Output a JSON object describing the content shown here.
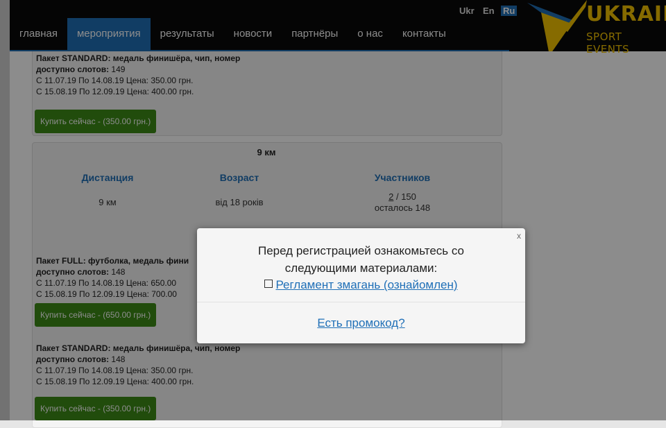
{
  "header": {
    "languages": [
      {
        "label": "Ukr",
        "active": false
      },
      {
        "label": "En",
        "active": false
      },
      {
        "label": "Ru",
        "active": true
      }
    ],
    "nav": [
      {
        "label": "главная",
        "active": false
      },
      {
        "label": "мероприятия",
        "active": true
      },
      {
        "label": "результаты",
        "active": false
      },
      {
        "label": "новости",
        "active": false
      },
      {
        "label": "партнёры",
        "active": false
      },
      {
        "label": "о нас",
        "active": false
      },
      {
        "label": "контакты",
        "active": false
      }
    ],
    "logo": {
      "line1": "UKRAINE",
      "line2": "SPORT EVENTS"
    }
  },
  "top_package": {
    "title": "Пакет STANDARD: медаль финишёра, чип, номер",
    "slots_label": "доступно слотов:",
    "slots_value": "149",
    "price1": "С 11.07.19 По 14.08.19 Цена: 350.00 грн.",
    "price2": "С 15.08.19 По 12.09.19 Цена: 400.00 грн.",
    "buy_button": "Купить сейчас - (350.00 грн.)"
  },
  "distance_card": {
    "title": "9 км",
    "headers": {
      "distance": "Дистанция",
      "age": "Возраст",
      "participants": "Участников"
    },
    "values": {
      "distance": "9 км",
      "age": "від 18 років",
      "participants_count": "2",
      "participants_total": "/ 150",
      "remaining": "осталось 148"
    }
  },
  "full_package": {
    "title": "Пакет FULL: футболка, медаль фини",
    "slots_label": "доступно слотов:",
    "slots_value": "148",
    "price1": "С 11.07.19 По 14.08.19 Цена: 650.00",
    "price2": "С 15.08.19 По 12.09.19 Цена: 700.00",
    "buy_button": "Купить сейчас - (650.00 грн.)"
  },
  "standard_package": {
    "title": "Пакет STANDARD: медаль финишёра, чип, номер",
    "slots_label": "доступно слотов:",
    "slots_value": "148",
    "price1": "С 11.07.19 По 14.08.19 Цена: 350.00 грн.",
    "price2": "С 15.08.19 По 12.09.19 Цена: 400.00 грн.",
    "buy_button": "Купить сейчас - (350.00 грн.)"
  },
  "modal": {
    "close": "x",
    "line1": "Перед регистрацией ознакомьтесь со",
    "line2": "следующими материалами:",
    "checkbox_symbol": "",
    "rules_link": "Регламент змагань (ознайомлен)",
    "promo_link": "Есть промокод?"
  },
  "colors": {
    "accent": "#1f6fb7",
    "button": "#3c8a16",
    "logo": "#f5c400"
  }
}
